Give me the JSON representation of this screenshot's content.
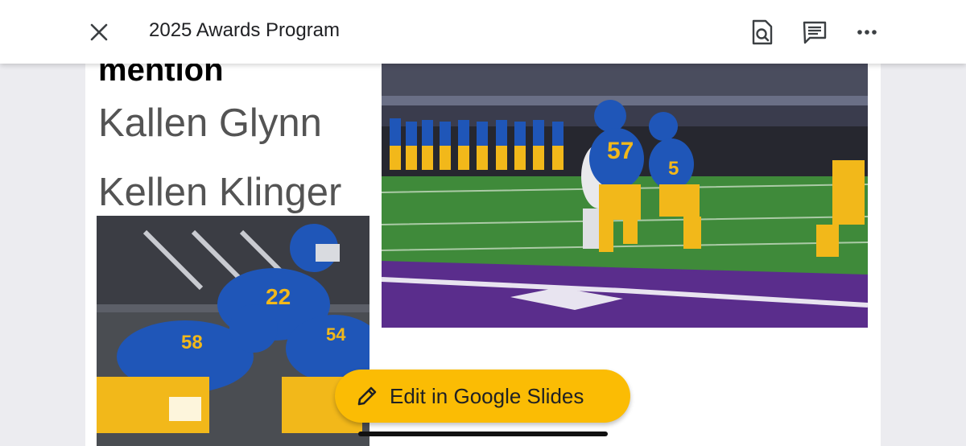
{
  "header": {
    "title": "2025 Awards Program",
    "icons": [
      "close-icon",
      "find-in-page-icon",
      "comment-icon",
      "more-icon"
    ]
  },
  "slide": {
    "heading": "mention",
    "names": [
      "Kallen Glynn",
      "Kellen Klinger"
    ],
    "photos": [
      {
        "kind": "football-action-photo",
        "jerseys": [
          "57",
          "5"
        ]
      },
      {
        "kind": "football-lineup-photo",
        "jerseys": [
          "22",
          "58",
          "54"
        ]
      }
    ]
  },
  "fab": {
    "label": "Edit in Google Slides",
    "icon": "pencil-icon",
    "color": "#fbbc04"
  },
  "colors": {
    "team_blue": "#1f56b8",
    "team_gold": "#f2b81a",
    "field_green": "#3f8a3a",
    "end_zone_purple": "#5a2d8c"
  }
}
